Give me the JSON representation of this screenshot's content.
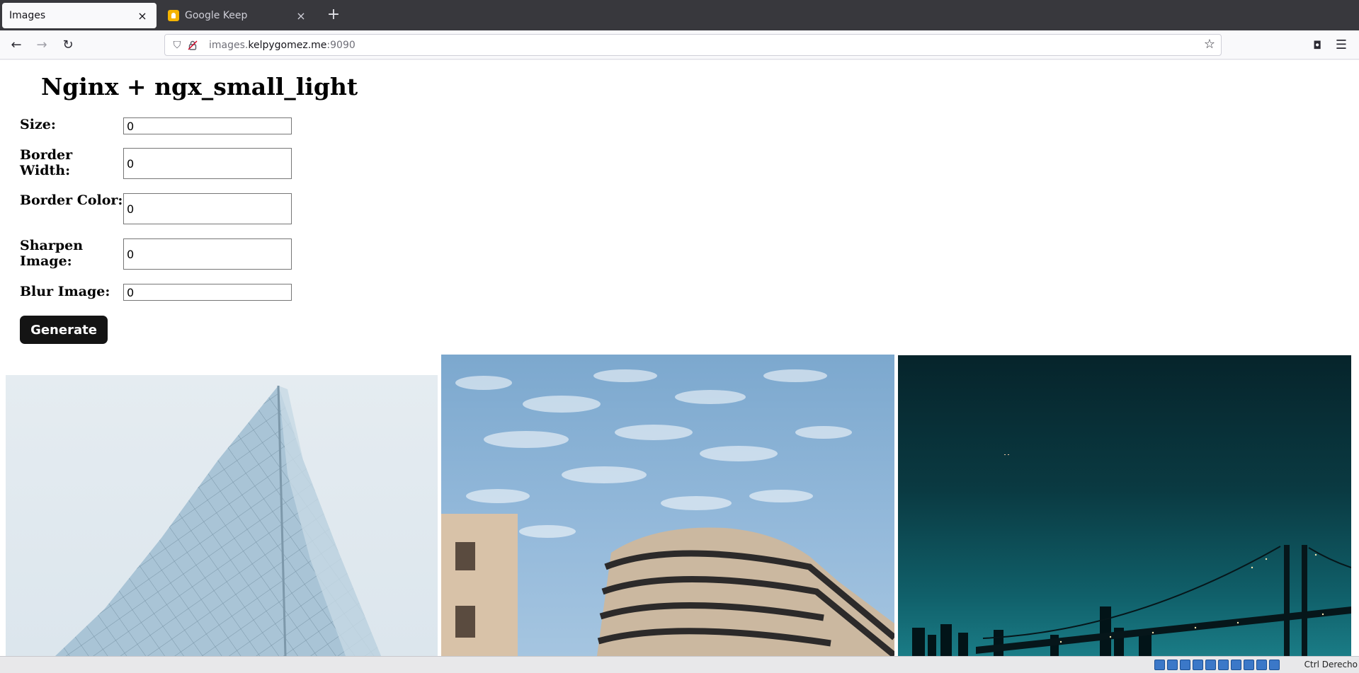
{
  "browser": {
    "tabs": [
      {
        "title": "Images",
        "close": "×",
        "active": true
      },
      {
        "title": "Google Keep",
        "close": "×",
        "active": false
      }
    ],
    "new_tab": "+",
    "url": {
      "prefix": "images.",
      "host": "kelpygomez.me",
      "port": ":9090"
    },
    "icons": {
      "back": "←",
      "forward": "→",
      "reload": "↻",
      "shield": "⛉",
      "lock": "🔒",
      "star": "☆",
      "pocket": "◘",
      "menu": "☰"
    }
  },
  "page": {
    "title": "Nginx + ngx_small_light",
    "form": {
      "size": {
        "label": "Size:",
        "value": "0"
      },
      "border_width": {
        "label": "Border Width:",
        "value": "0"
      },
      "border_color": {
        "label": "Border Color:",
        "value": "0"
      },
      "sharpen": {
        "label": "Sharpen Image:",
        "value": "0"
      },
      "blur": {
        "label": "Blur Image:",
        "value": "0"
      },
      "generate_label": "Generate"
    },
    "images": [
      {
        "subject": "glass building facade"
      },
      {
        "subject": "office building under clouds"
      },
      {
        "subject": "bridge at night"
      }
    ]
  },
  "status": {
    "host_key": "Ctrl Derecho"
  }
}
